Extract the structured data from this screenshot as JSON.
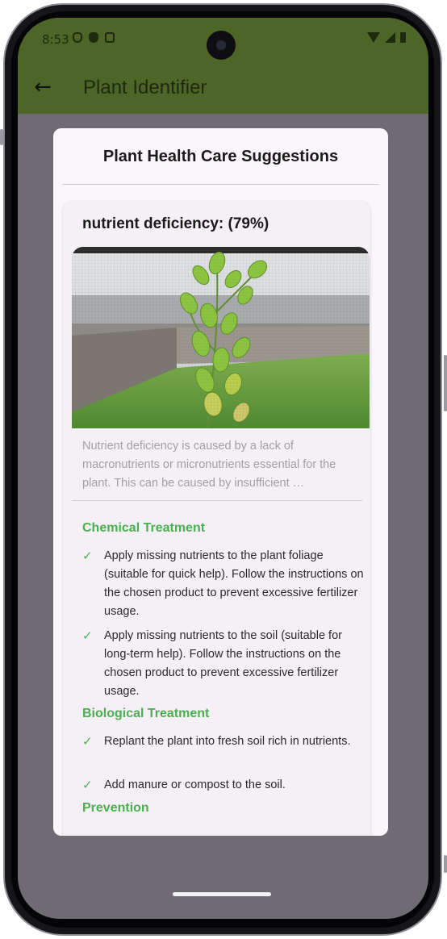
{
  "status_bar": {
    "time": "8:53",
    "left_icons": [
      "shield-outline-icon",
      "shield-filled-icon",
      "a-box-icon"
    ],
    "right_icons": [
      "wifi-icon",
      "signal-icon",
      "battery-icon"
    ]
  },
  "app_bar": {
    "back_icon": "arrow-left-icon",
    "back_glyph": "←",
    "title": "Plant Identifier",
    "color": "#4d6527"
  },
  "dialog": {
    "title": "Plant Health Care Suggestions",
    "disease": {
      "title": "nutrient deficiency: (79%)",
      "image": "plant-photo",
      "description": "Nutrient deficiency is caused by a lack of macronutrients or micronutrients essential for the plant. This can be caused by insufficient …",
      "sections": [
        {
          "title": "Chemical Treatment",
          "items": [
            "Apply missing nutrients to the plant foliage (suitable for quick help). Follow the instructions on the chosen product to prevent excessive fertilizer usage.",
            "Apply missing nutrients to the soil (suitable for long-term help). Follow the instructions on the chosen product to prevent excessive fertilizer usage."
          ]
        },
        {
          "title": "Biological Treatment",
          "items": [
            "Replant the plant into fresh soil rich in nutrients.",
            "Add manure or compost to the soil."
          ]
        },
        {
          "title": "Prevention",
          "items": []
        }
      ]
    }
  },
  "check_glyph": "✓",
  "colors": {
    "accent_green": "#4caf50",
    "dialog_bg": "#fbf6fb",
    "scrim": "#6f6b72"
  }
}
